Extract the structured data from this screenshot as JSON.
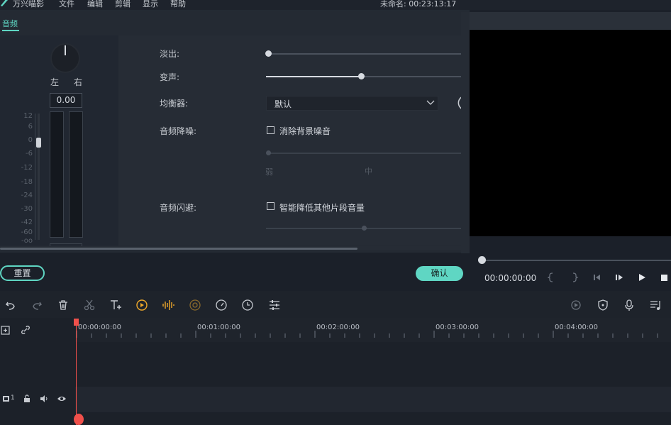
{
  "menu": {
    "items": [
      "万兴喵影",
      "文件",
      "编辑",
      "剪辑",
      "显示",
      "帮助"
    ],
    "doc_title": "未命名: 00:23:13:17"
  },
  "tabs": {
    "audio": "音频"
  },
  "meter": {
    "left_label": "左",
    "right_label": "右",
    "pan_value": "0.00",
    "db_ticks": [
      "12",
      "6",
      "0",
      "-6",
      "-12",
      "-18",
      "-24",
      "-30",
      "-42",
      "-60",
      "-oo"
    ]
  },
  "settings": {
    "fade_out_label": "淡出:",
    "fade_out_value": 0.0,
    "voice_change_label": "变声:",
    "voice_change_value": 0.5,
    "equalizer_label": "均衡器:",
    "equalizer_value": "默认",
    "denoise_label": "音频降噪:",
    "denoise_checkbox_label": "消除背景噪音",
    "denoise_checked": false,
    "denoise_level_low": "弱",
    "denoise_level_mid": "中",
    "ducking_label": "音频闪避:",
    "ducking_checkbox_label": "智能降低其他片段音量",
    "ducking_checked": false
  },
  "buttons": {
    "reset": "重置",
    "ok": "确认"
  },
  "player": {
    "timecode": "00:00:00:00"
  },
  "timeline": {
    "ruler": [
      "00:00:00:00",
      "00:01:00:00",
      "00:02:00:00",
      "00:03:00:00",
      "00:04:00:00"
    ],
    "track_number": "1"
  },
  "colors": {
    "accent": "#5fd6c3",
    "playhead": "#f0504b",
    "toolbar_highlight": "#f0a92a"
  }
}
